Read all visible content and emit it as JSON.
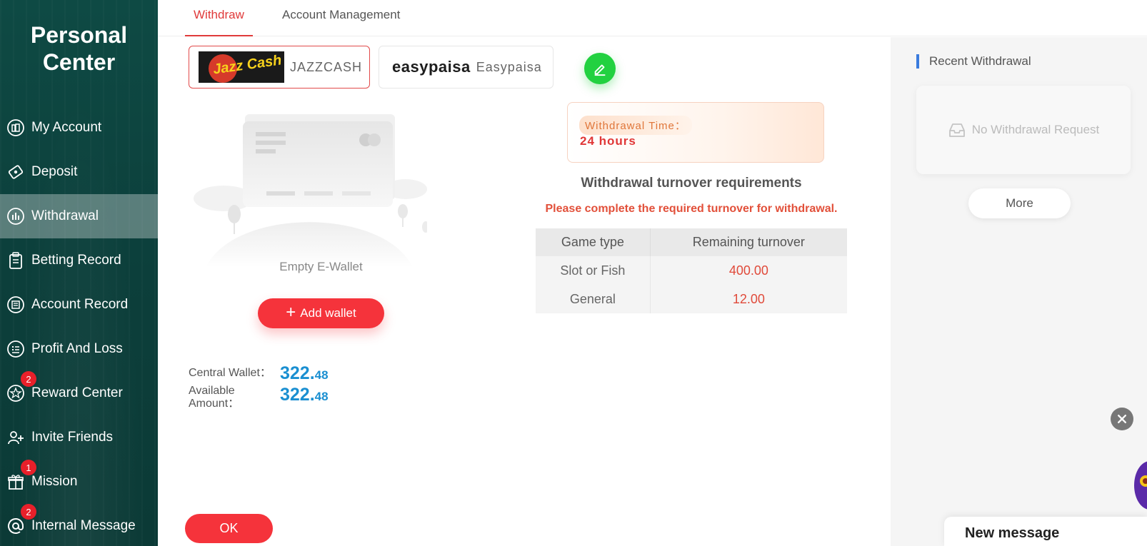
{
  "sidebar": {
    "title_line1": "Personal",
    "title_line2": "Center",
    "items": [
      {
        "label": "My Account",
        "icon": "account-icon",
        "badge": null
      },
      {
        "label": "Deposit",
        "icon": "deposit-icon",
        "badge": null
      },
      {
        "label": "Withdrawal",
        "icon": "withdrawal-icon",
        "badge": null,
        "active": true
      },
      {
        "label": "Betting Record",
        "icon": "clipboard-icon",
        "badge": null
      },
      {
        "label": "Account Record",
        "icon": "ledger-icon",
        "badge": null
      },
      {
        "label": "Profit And Loss",
        "icon": "list-icon",
        "badge": null
      },
      {
        "label": "Reward Center",
        "icon": "star-icon",
        "badge": "2"
      },
      {
        "label": "Invite Friends",
        "icon": "invite-icon",
        "badge": null
      },
      {
        "label": "Mission",
        "icon": "gift-icon",
        "badge": "1"
      },
      {
        "label": "Internal Message",
        "icon": "at-icon",
        "badge": "2"
      }
    ]
  },
  "tabs": [
    {
      "label": "Withdraw",
      "active": true
    },
    {
      "label": "Account Management",
      "active": false
    }
  ],
  "wallets": [
    {
      "logo_text": "Jazz Cash",
      "name": "JAZZCASH",
      "selected": true
    },
    {
      "logo_text": "easypaisa",
      "name": "Easypaisa",
      "selected": false
    }
  ],
  "empty_wallet_text": "Empty E-Wallet",
  "add_wallet_label": "Add wallet",
  "balances": {
    "central_label": "Central Wallet：",
    "central_int": "322.",
    "central_dec": "48",
    "available_label_line1": "Available",
    "available_label_line2": "Amount：",
    "available_int": "322.",
    "available_dec": "48"
  },
  "withdrawal_time": {
    "label": "Withdrawal Time：",
    "value": "24 hours"
  },
  "turnover": {
    "title": "Withdrawal turnover requirements",
    "subtitle": "Please complete the required turnover for withdrawal.",
    "headers": [
      "Game type",
      "Remaining turnover"
    ],
    "rows": [
      {
        "game": "Slot or Fish",
        "amount": "400.00"
      },
      {
        "game": "General",
        "amount": "12.00"
      }
    ]
  },
  "ok_label": "OK",
  "recent": {
    "title": "Recent Withdrawal",
    "empty_text": "No Withdrawal Request",
    "more_label": "More"
  },
  "new_message_label": "New message",
  "colors": {
    "accent_red": "#f5333b",
    "sidebar_green": "#0c3f3b",
    "balance_blue": "#1a8fd1",
    "edit_green": "#22d140"
  }
}
